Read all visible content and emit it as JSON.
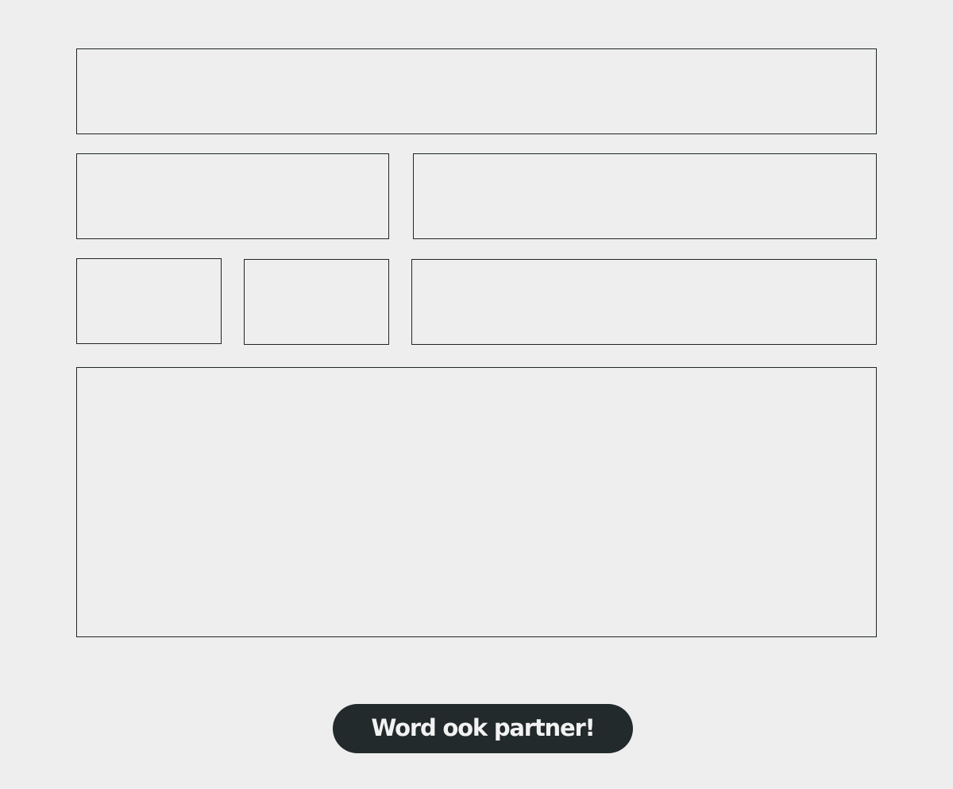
{
  "form": {
    "fields": [
      {
        "id": "field-1"
      },
      {
        "id": "field-2"
      },
      {
        "id": "field-3"
      },
      {
        "id": "field-4"
      },
      {
        "id": "field-5"
      },
      {
        "id": "field-6"
      },
      {
        "id": "field-7"
      }
    ]
  },
  "cta": {
    "label": "Word ook partner!"
  },
  "colors": {
    "background": "#eeeeee",
    "border": "#1f2526",
    "button_bg": "#232a2b",
    "button_text": "#f2f2f2"
  }
}
